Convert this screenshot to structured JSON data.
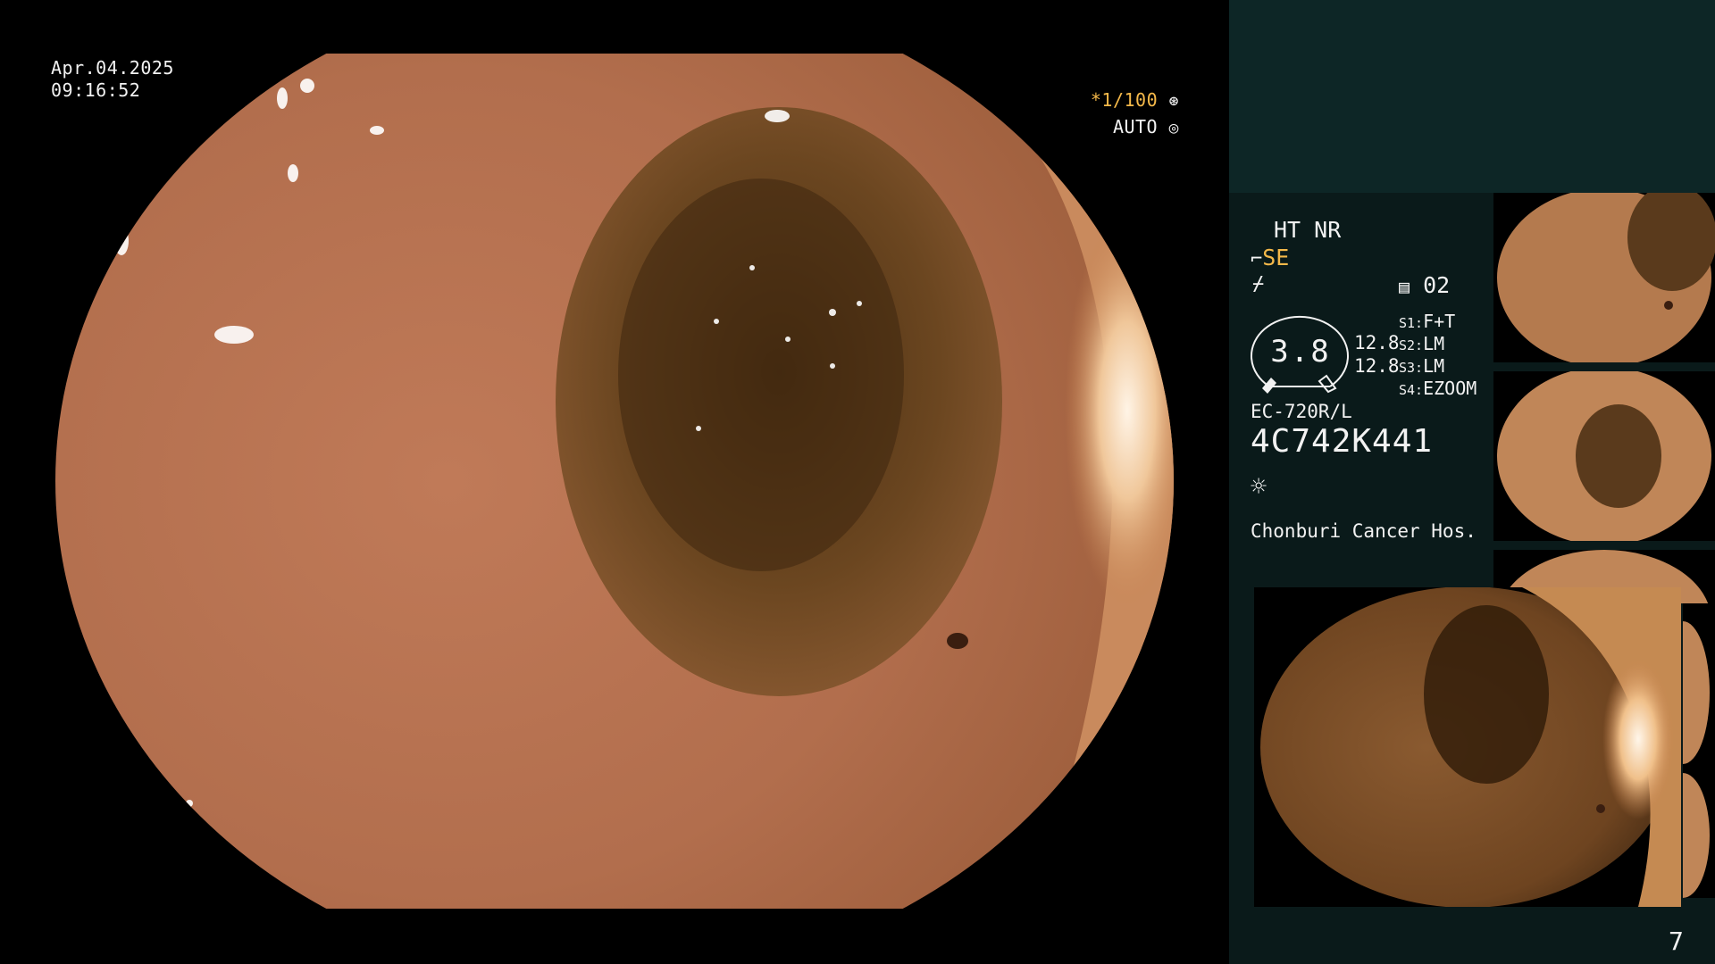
{
  "overlay": {
    "date": "Apr.04.2025",
    "time": "09:16:52",
    "shutter_speed": "*1/100",
    "iris_mode": "AUTO"
  },
  "processor": {
    "mode_line1": "HT NR",
    "mode_se": "SE",
    "capture_count": "02",
    "gauge_value": "3.8",
    "gauge_right_top": "12.8",
    "gauge_right_bottom": "12.8",
    "switches": [
      {
        "key": "S1:",
        "value": "F+T"
      },
      {
        "key": "S2:",
        "value": "LM"
      },
      {
        "key": "S3:",
        "value": "LM"
      },
      {
        "key": "S4:",
        "value": "EZOOM"
      }
    ],
    "scope_model": "EC-720R/L",
    "scope_serial": "4C742K441",
    "hospital": "Chonburi Cancer Hos."
  },
  "page": {
    "number": "7"
  },
  "icons": [
    "aperture-icon",
    "auto-iris-icon",
    "structure-enhance-icon",
    "color-tone-icon",
    "capture-memory-icon",
    "light-source-icon"
  ],
  "colors": {
    "accent": "#f5b94a",
    "panel_bg": "#0a1a1a",
    "panel_top": "#0d2626"
  }
}
